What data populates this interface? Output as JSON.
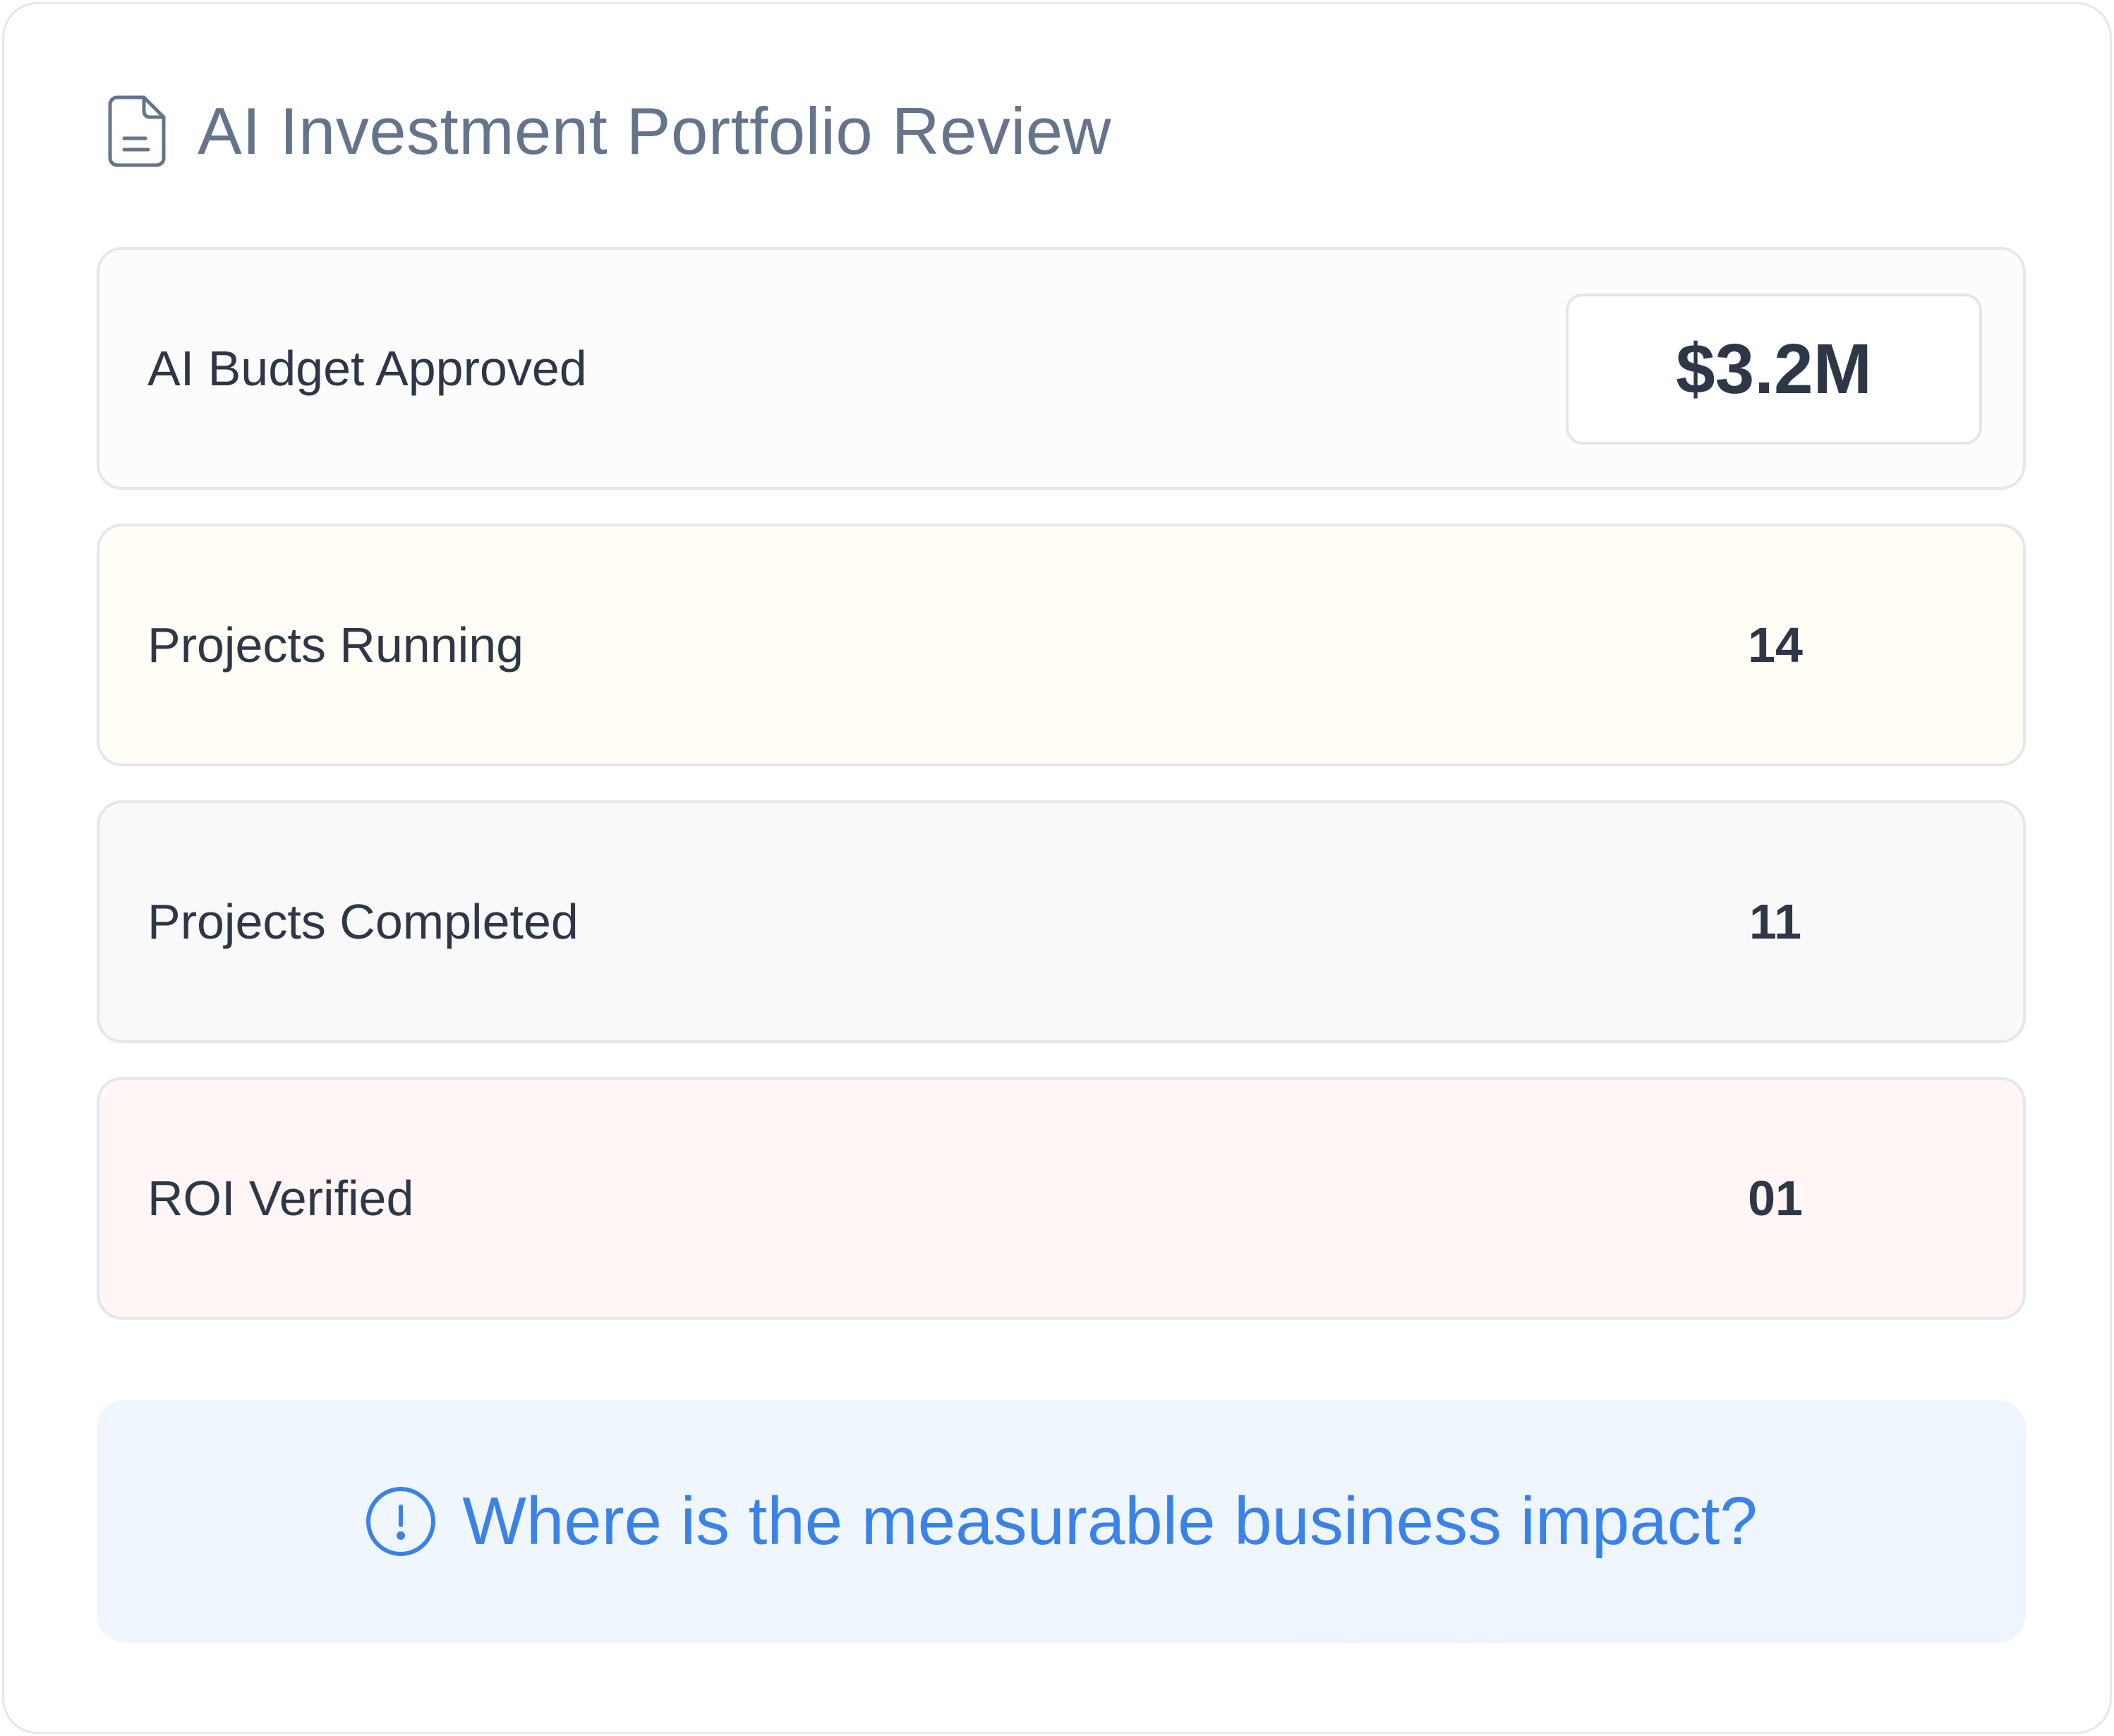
{
  "header": {
    "title": "AI Investment Portfolio Review",
    "icon": "document-icon"
  },
  "metrics": [
    {
      "label": "AI Budget Approved",
      "value": "$3.2M",
      "highlight": "neutral"
    },
    {
      "label": "Projects Running",
      "value": "14",
      "highlight": "amber"
    },
    {
      "label": "Projects Completed",
      "value": "11",
      "highlight": "gray"
    },
    {
      "label": "ROI Verified",
      "value": "01",
      "highlight": "red"
    }
  ],
  "callout": {
    "text": "Where is the measurable business impact?",
    "icon": "alert-circle-icon"
  },
  "colors": {
    "accent": "#3b82e8",
    "text": "#2d3748",
    "title": "#64748b",
    "running_bg": "#fffdf5",
    "completed_bg": "#f9f9f9",
    "roi_bg": "#fff6f5",
    "callout_bg": "#eff6fd"
  }
}
